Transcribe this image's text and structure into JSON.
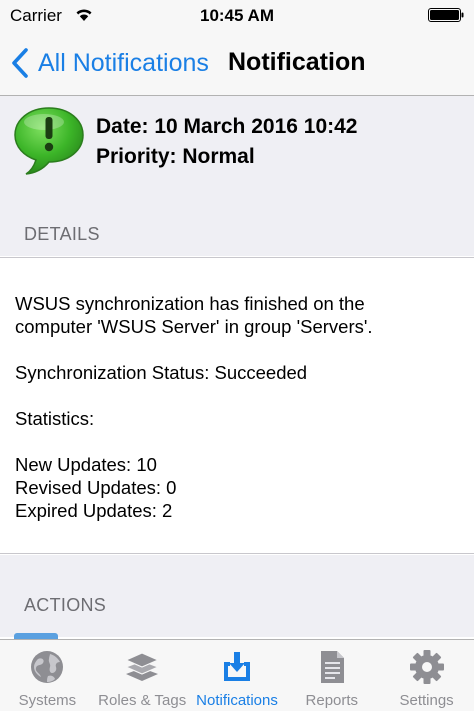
{
  "status_bar": {
    "carrier": "Carrier",
    "time": "10:45 AM"
  },
  "nav": {
    "back_label": "All Notifications",
    "title": "Notification"
  },
  "header": {
    "date_line": "Date: 10 March 2016 10:42",
    "priority_line": "Priority: Normal",
    "details_label": "DETAILS"
  },
  "details": {
    "line1": "WSUS synchronization has finished on the",
    "line2": "computer 'WSUS Server' in group 'Servers'.",
    "sync_status": "Synchronization Status: Succeeded",
    "statistics_label": "Statistics:",
    "new_updates": "New Updates: 10",
    "revised_updates": "Revised Updates: 0",
    "expired_updates": "Expired Updates: 2"
  },
  "actions": {
    "label": "ACTIONS"
  },
  "tabs": [
    {
      "label": "Systems",
      "icon": "globe-icon"
    },
    {
      "label": "Roles & Tags",
      "icon": "layers-icon"
    },
    {
      "label": "Notifications",
      "icon": "inbox-download-icon"
    },
    {
      "label": "Reports",
      "icon": "document-icon"
    },
    {
      "label": "Settings",
      "icon": "gear-icon"
    }
  ],
  "colors": {
    "accent": "#1a7fe5",
    "bubble_green": "#3cb528",
    "inactive": "#8e8e93"
  }
}
